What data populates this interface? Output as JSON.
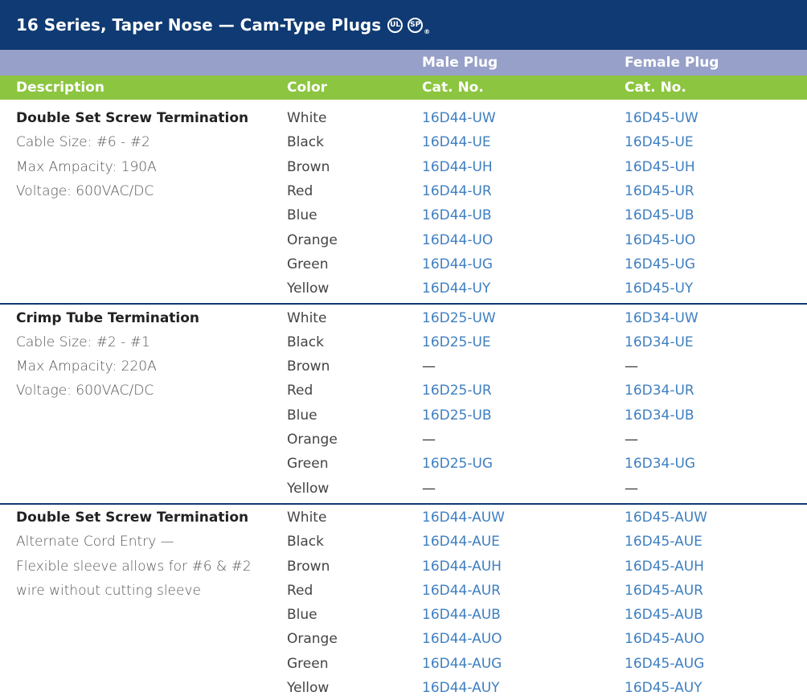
{
  "title": "16 Series, Taper Nose — Cam-Type Plugs",
  "certifications": [
    "UL",
    "CSA"
  ],
  "certification_icons": [
    "ul-listed-icon",
    "csa-certified-icon"
  ],
  "header": {
    "male_plug": "Male Plug",
    "female_plug": "Female Plug",
    "description": "Description",
    "color": "Color",
    "cat_no_male": "Cat. No.",
    "cat_no_female": "Cat. No."
  },
  "colors": {
    "title_bar": "#0f3a73",
    "sub_header": "#97a0c8",
    "column_header": "#8cc540",
    "catalog_text": "#3f7fc1"
  },
  "groups": [
    {
      "title": "Double Set Screw Termination",
      "details": [
        "Cable Size: #6 - #2",
        "Max Ampacity: 190A",
        "Voltage: 600VAC/DC"
      ],
      "rows": [
        {
          "color": "White",
          "male": "16D44-UW",
          "female": "16D45-UW"
        },
        {
          "color": "Black",
          "male": "16D44-UE",
          "female": "16D45-UE"
        },
        {
          "color": "Brown",
          "male": "16D44-UH",
          "female": "16D45-UH"
        },
        {
          "color": "Red",
          "male": "16D44-UR",
          "female": "16D45-UR"
        },
        {
          "color": "Blue",
          "male": "16D44-UB",
          "female": "16D45-UB"
        },
        {
          "color": "Orange",
          "male": "16D44-UO",
          "female": "16D45-UO"
        },
        {
          "color": "Green",
          "male": "16D44-UG",
          "female": "16D45-UG"
        },
        {
          "color": "Yellow",
          "male": "16D44-UY",
          "female": "16D45-UY"
        }
      ]
    },
    {
      "title": "Crimp Tube Termination",
      "details": [
        "Cable Size: #2 - #1",
        "Max Ampacity: 220A",
        "Voltage: 600VAC/DC"
      ],
      "rows": [
        {
          "color": "White",
          "male": "16D25-UW",
          "female": "16D34-UW"
        },
        {
          "color": "Black",
          "male": "16D25-UE",
          "female": "16D34-UE"
        },
        {
          "color": "Brown",
          "male": "—",
          "female": "—"
        },
        {
          "color": "Red",
          "male": "16D25-UR",
          "female": "16D34-UR"
        },
        {
          "color": "Blue",
          "male": "16D25-UB",
          "female": "16D34-UB"
        },
        {
          "color": "Orange",
          "male": "—",
          "female": "—"
        },
        {
          "color": "Green",
          "male": "16D25-UG",
          "female": "16D34-UG"
        },
        {
          "color": "Yellow",
          "male": "—",
          "female": "—"
        }
      ]
    },
    {
      "title": "Double Set Screw Termination",
      "details": [
        "Alternate Cord Entry —",
        "Flexible sleeve allows for #6 & #2",
        "wire without cutting sleeve"
      ],
      "rows": [
        {
          "color": "White",
          "male": "16D44-AUW",
          "female": "16D45-AUW"
        },
        {
          "color": "Black",
          "male": "16D44-AUE",
          "female": "16D45-AUE"
        },
        {
          "color": "Brown",
          "male": "16D44-AUH",
          "female": "16D45-AUH"
        },
        {
          "color": "Red",
          "male": "16D44-AUR",
          "female": "16D45-AUR"
        },
        {
          "color": "Blue",
          "male": "16D44-AUB",
          "female": "16D45-AUB"
        },
        {
          "color": "Orange",
          "male": "16D44-AUO",
          "female": "16D45-AUO"
        },
        {
          "color": "Green",
          "male": "16D44-AUG",
          "female": "16D45-AUG"
        },
        {
          "color": "Yellow",
          "male": "16D44-AUY",
          "female": "16D45-AUY"
        }
      ]
    }
  ]
}
